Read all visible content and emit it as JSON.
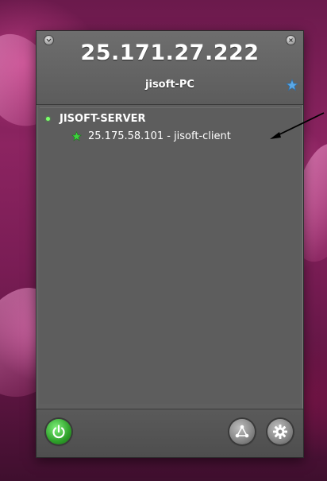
{
  "header": {
    "ip_address": "25.171.27.222",
    "computer_name": "jisoft-PC"
  },
  "network": {
    "group_name": "JISOFT-SERVER",
    "members": [
      {
        "label": "25.175.58.101 - jisoft-client",
        "status_icon": "star-icon",
        "status_color": "#3fd33f"
      }
    ]
  },
  "footer": {
    "power_icon": "power-icon",
    "network_icon": "network-icon",
    "settings_icon": "gear-icon"
  },
  "colors": {
    "panel": "#5f5f5f",
    "online_green": "#3fd33f",
    "favorite_blue": "#5aa8e6"
  }
}
